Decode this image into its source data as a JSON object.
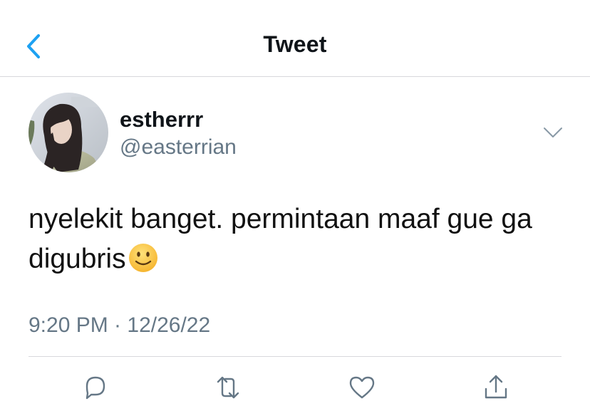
{
  "header": {
    "title": "Tweet",
    "back_icon": "chevron-left-icon",
    "accent_color": "#1da1f2"
  },
  "tweet": {
    "author": {
      "name": "estherrr",
      "handle": "@easterrian"
    },
    "text": "nyelekit banget. permintaan maaf gue ga digubris",
    "emoji": "slightly-smiling-face",
    "meta": "9:20 PM · 12/26/22",
    "more_icon": "chevron-down-icon"
  },
  "actions": [
    {
      "name": "reply",
      "icon": "speech-bubble-icon"
    },
    {
      "name": "retweet",
      "icon": "retweet-arrows-icon"
    },
    {
      "name": "like",
      "icon": "heart-icon"
    },
    {
      "name": "share",
      "icon": "share-upload-icon"
    }
  ],
  "colors": {
    "text": "#0f1419",
    "secondary": "#657786",
    "divider": "#d8d8dc"
  }
}
